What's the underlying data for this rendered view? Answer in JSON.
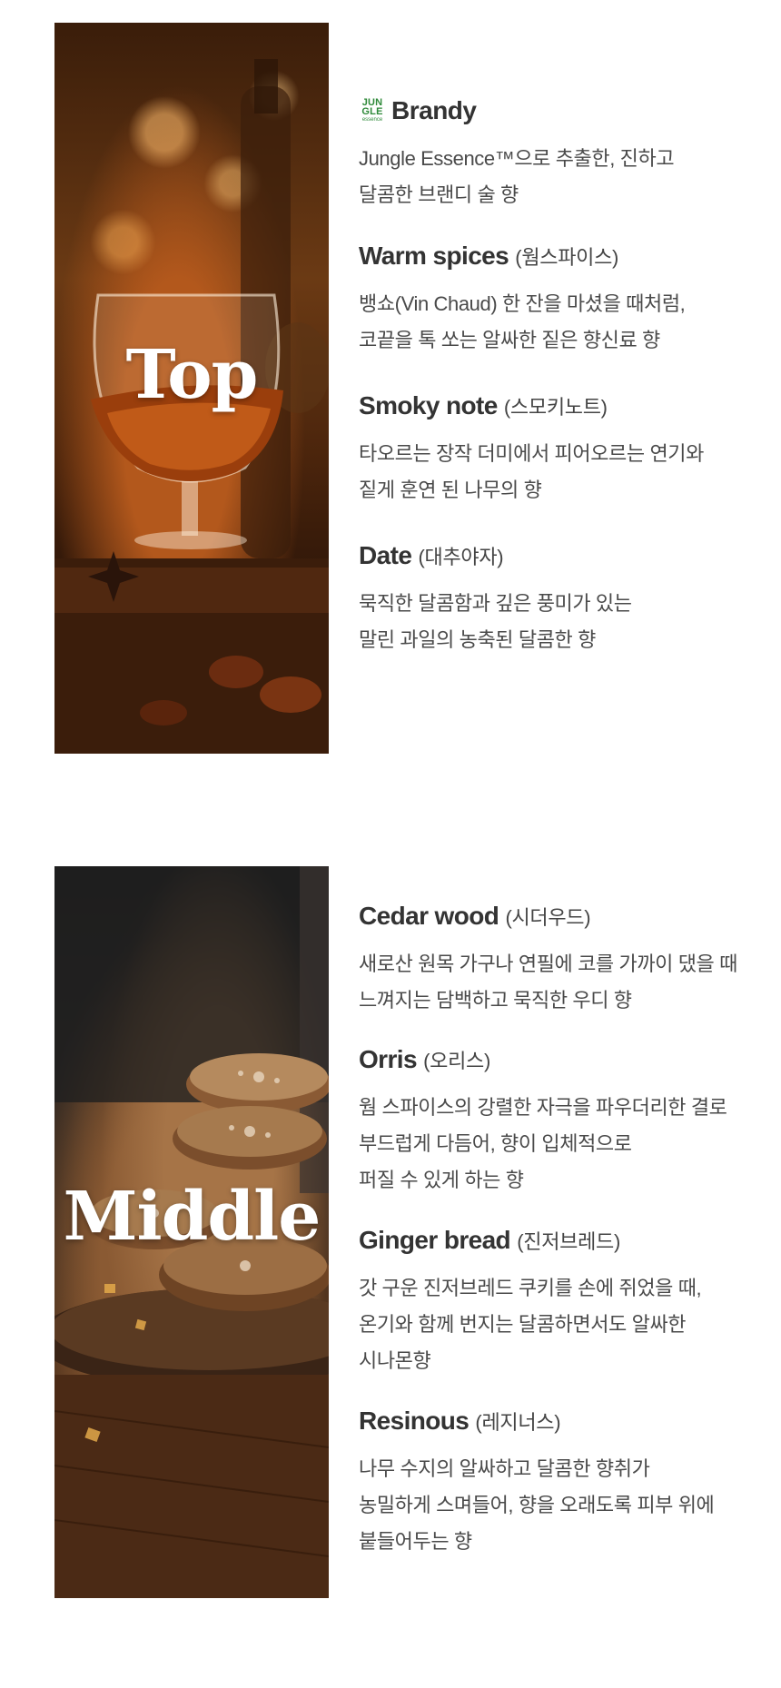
{
  "top": {
    "overlay_word": "Top",
    "brand": {
      "logo_lines": [
        "JUN",
        "GLE",
        "essence"
      ],
      "name": "Brandy",
      "desc_lines": [
        "Jungle Essence™으로 추출한, 진하고",
        "달콤한 브랜디 술 향"
      ]
    },
    "notes": [
      {
        "title": "Warm spices",
        "kr": "(웜스파이스)",
        "lines": [
          "뱅쇼(Vin Chaud) 한 잔을 마셨을 때처럼,",
          "코끝을 톡 쏘는 알싸한 짙은 향신료 향"
        ]
      },
      {
        "title": "Smoky note",
        "kr": "(스모키노트)",
        "lines": [
          "타오르는 장작 더미에서 피어오르는 연기와",
          "짙게 훈연 된 나무의 향"
        ]
      },
      {
        "title": "Date",
        "kr": "(대추야자)",
        "lines": [
          "묵직한 달콤함과 깊은 풍미가 있는",
          "말린 과일의 농축된 달콤한 향"
        ]
      }
    ]
  },
  "middle": {
    "overlay_word": "Middle",
    "notes": [
      {
        "title": "Cedar wood",
        "kr": "(시더우드)",
        "lines": [
          "새로산 원목 가구나 연필에 코를 가까이 댔을 때",
          "느껴지는 담백하고 묵직한 우디 향"
        ]
      },
      {
        "title": "Orris",
        "kr": "(오리스)",
        "lines": [
          "웜 스파이스의 강렬한 자극을 파우더리한 결로",
          "부드럽게 다듬어, 향이 입체적으로",
          "퍼질 수 있게 하는 향"
        ]
      },
      {
        "title": "Ginger bread",
        "kr": "(진저브레드)",
        "lines": [
          "갓 구운 진저브레드 쿠키를 손에 쥐었을 때,",
          "온기와 함께 번지는 달콤하면서도 알싸한",
          "시나몬향"
        ]
      },
      {
        "title": "Resinous",
        "kr": "(레지너스)",
        "lines": [
          "나무 수지의 알싸하고 달콤한 향취가",
          "농밀하게 스며들어,  향을 오래도록 피부 위에",
          "붙들어두는 향"
        ]
      }
    ]
  },
  "colors": {
    "text": "#333333",
    "brand_green": "#2f8a3a",
    "overlay_text": "#ffffff"
  }
}
